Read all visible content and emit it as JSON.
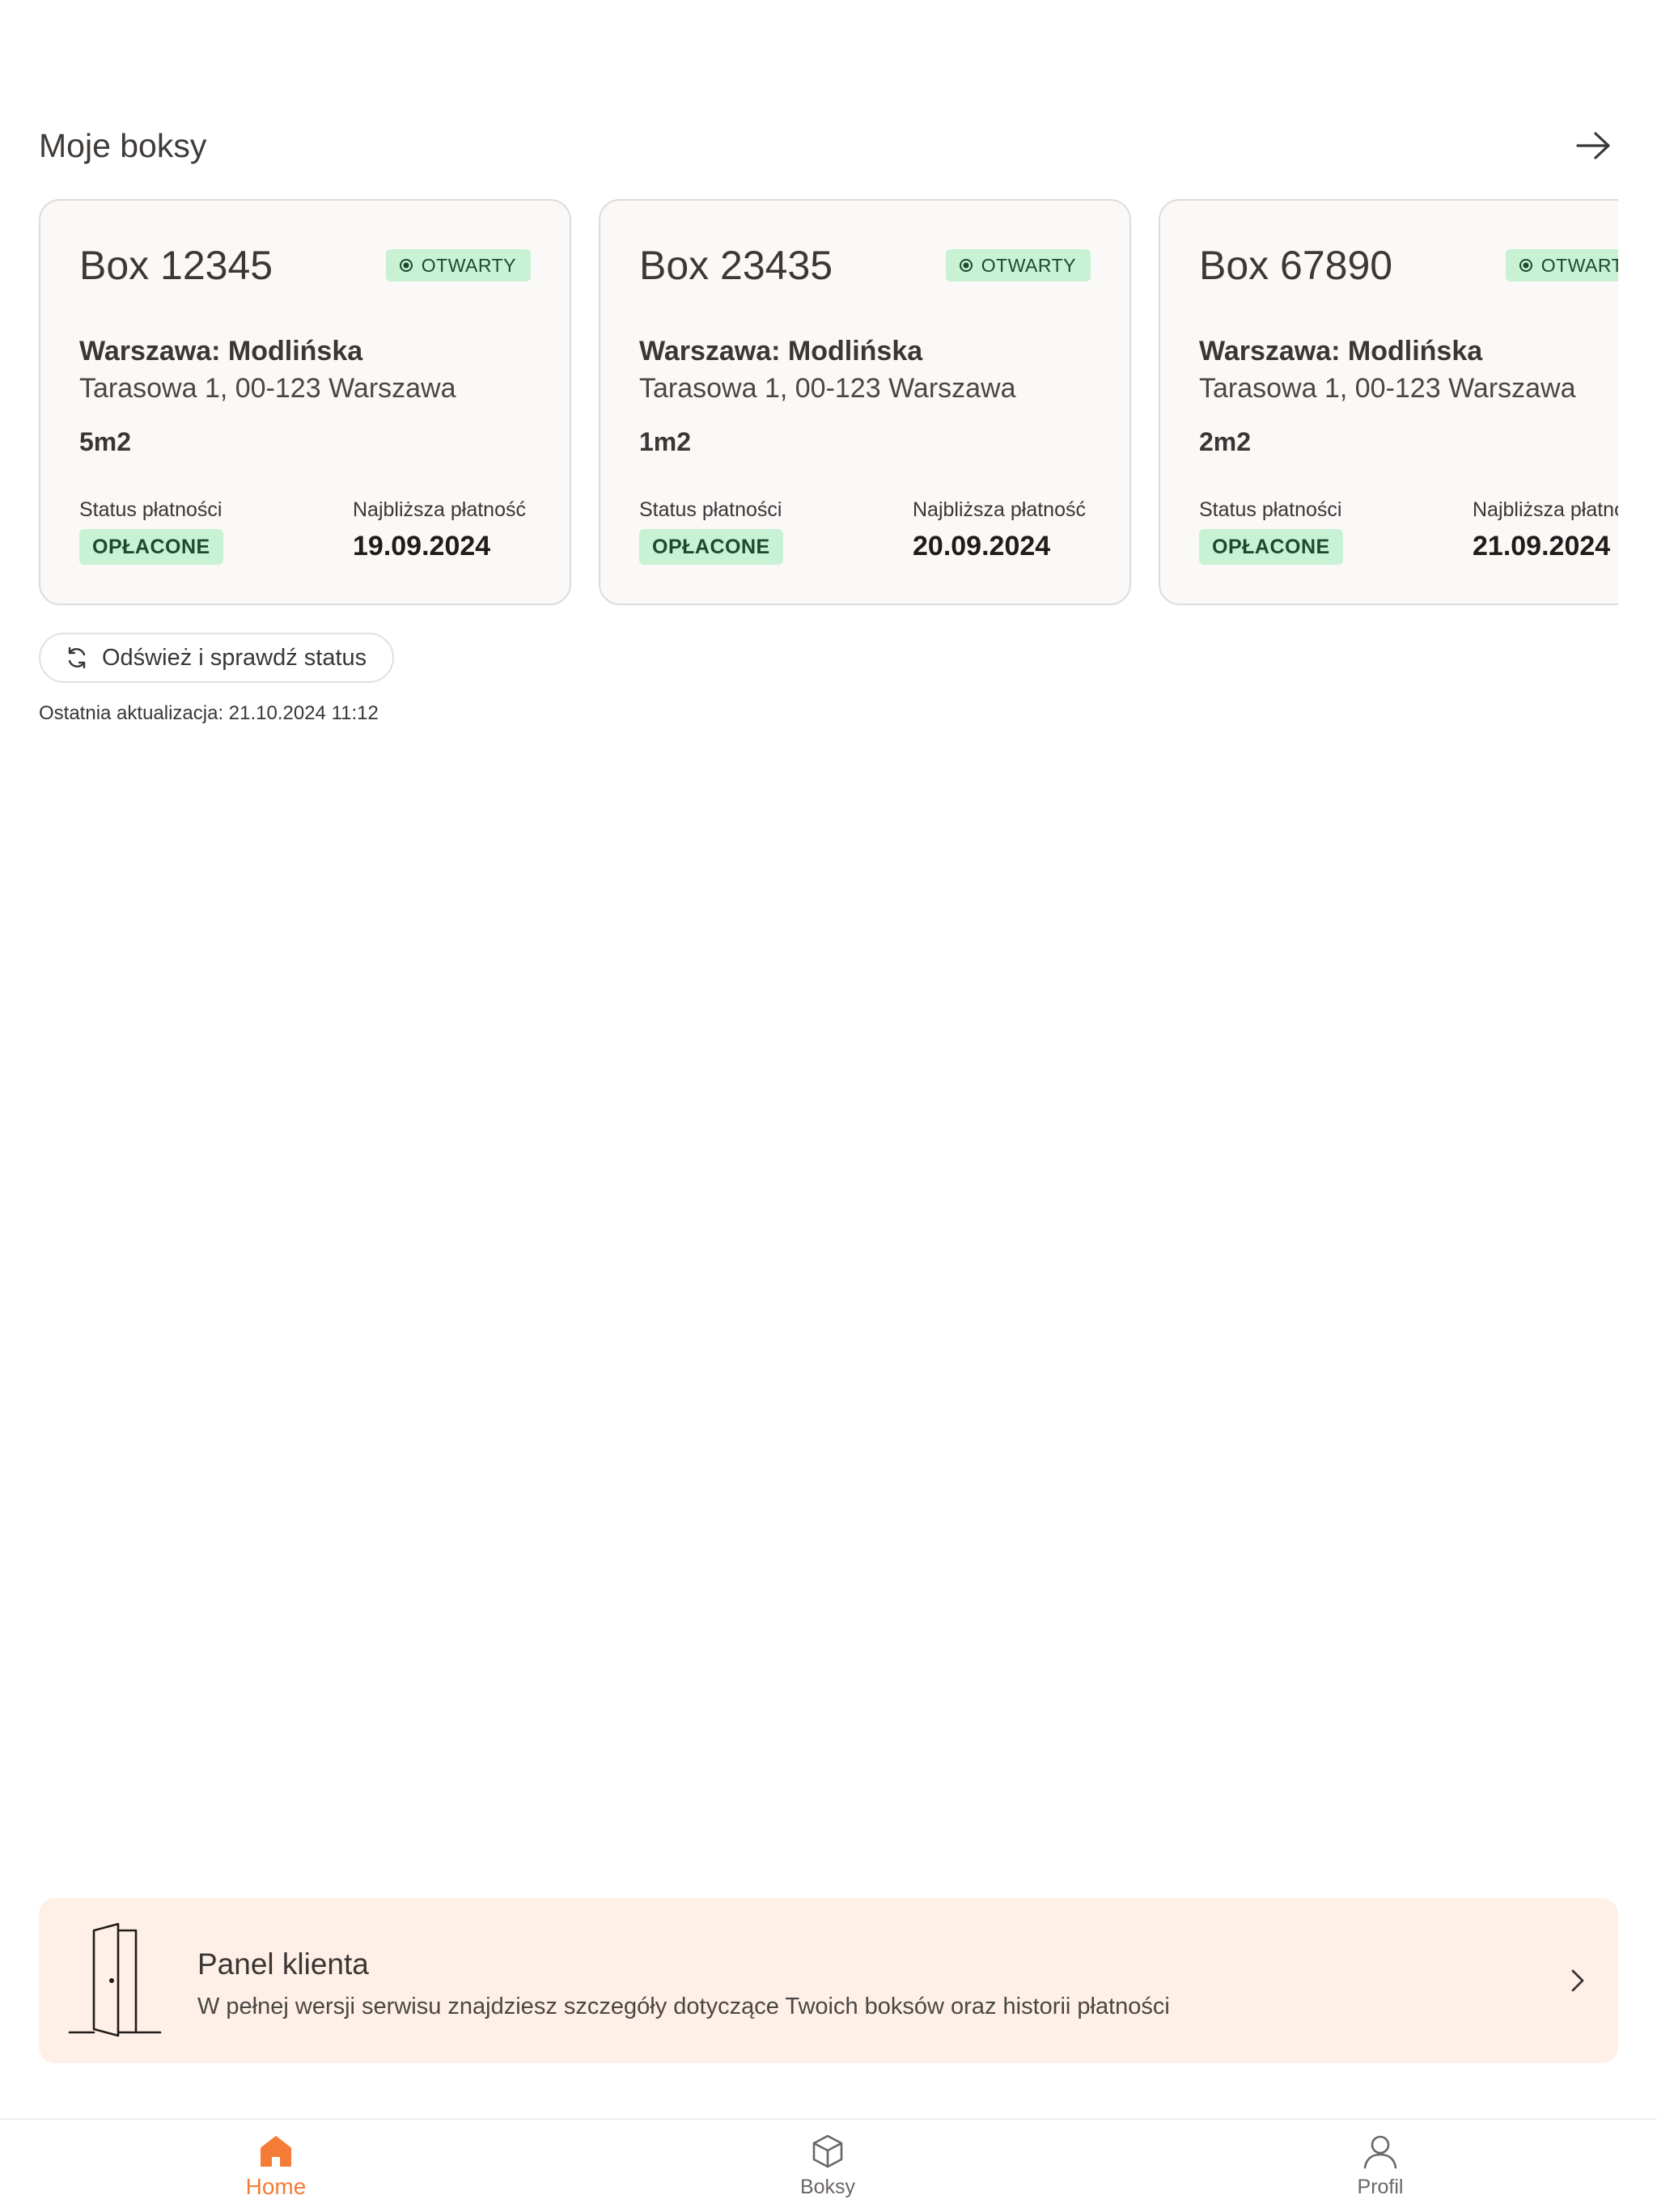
{
  "header": {
    "title": "Moje boksy",
    "arrow_icon": "arrow-right-icon"
  },
  "boxes": [
    {
      "name": "Box 12345",
      "badge": "OTWARTY",
      "location": "Warszawa: Modlińska",
      "address": "Tarasowa 1, 00-123 Warszawa",
      "size": "5m2",
      "payment_status_label": "Status płatności",
      "payment_status": "OPŁACONE",
      "next_payment_label": "Najbliższa płatność",
      "next_payment_date": "19.09.2024"
    },
    {
      "name": "Box 23435",
      "badge": "OTWARTY",
      "location": "Warszawa: Modlińska",
      "address": "Tarasowa 1, 00-123 Warszawa",
      "size": "1m2",
      "payment_status_label": "Status płatności",
      "payment_status": "OPŁACONE",
      "next_payment_label": "Najbliższa płatność",
      "next_payment_date": "20.09.2024"
    },
    {
      "name": "Box 67890",
      "badge": "OTWARTY",
      "location": "Warszawa: Modlińska",
      "address": "Tarasowa 1, 00-123 Warszawa",
      "size": "2m2",
      "payment_status_label": "Status płatności",
      "payment_status": "OPŁACONE",
      "next_payment_label": "Najbliższa płatność",
      "next_payment_date": "21.09.2024"
    }
  ],
  "refresh": {
    "label": "Odśwież i sprawdź status",
    "last_update": "Ostatnia aktualizacja: 21.10.2024 11:12"
  },
  "client_panel": {
    "title": "Panel klienta",
    "description": "W pełnej wersji serwisu znajdziesz szczegóły dotyczące Twoich boksów oraz historii płatności"
  },
  "nav": {
    "home": "Home",
    "boxes": "Boksy",
    "profile": "Profil"
  },
  "colors": {
    "accent": "#f47c36",
    "badge_bg": "#c9f1d4",
    "badge_text": "#1c4a2d",
    "card_bg": "#faf9f8",
    "panel_bg": "#fef0e6"
  }
}
